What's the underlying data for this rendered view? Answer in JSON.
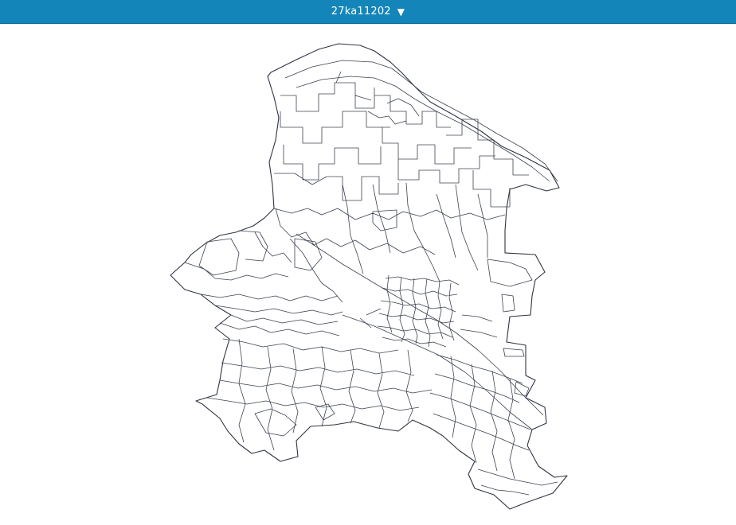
{
  "header": {
    "area_code": "27ka11202",
    "dropdown_icon": "triangle-down-icon",
    "bar_color": "#1485b8"
  },
  "map": {
    "boundary_color": "#3c4250",
    "background": "#ffffff"
  }
}
